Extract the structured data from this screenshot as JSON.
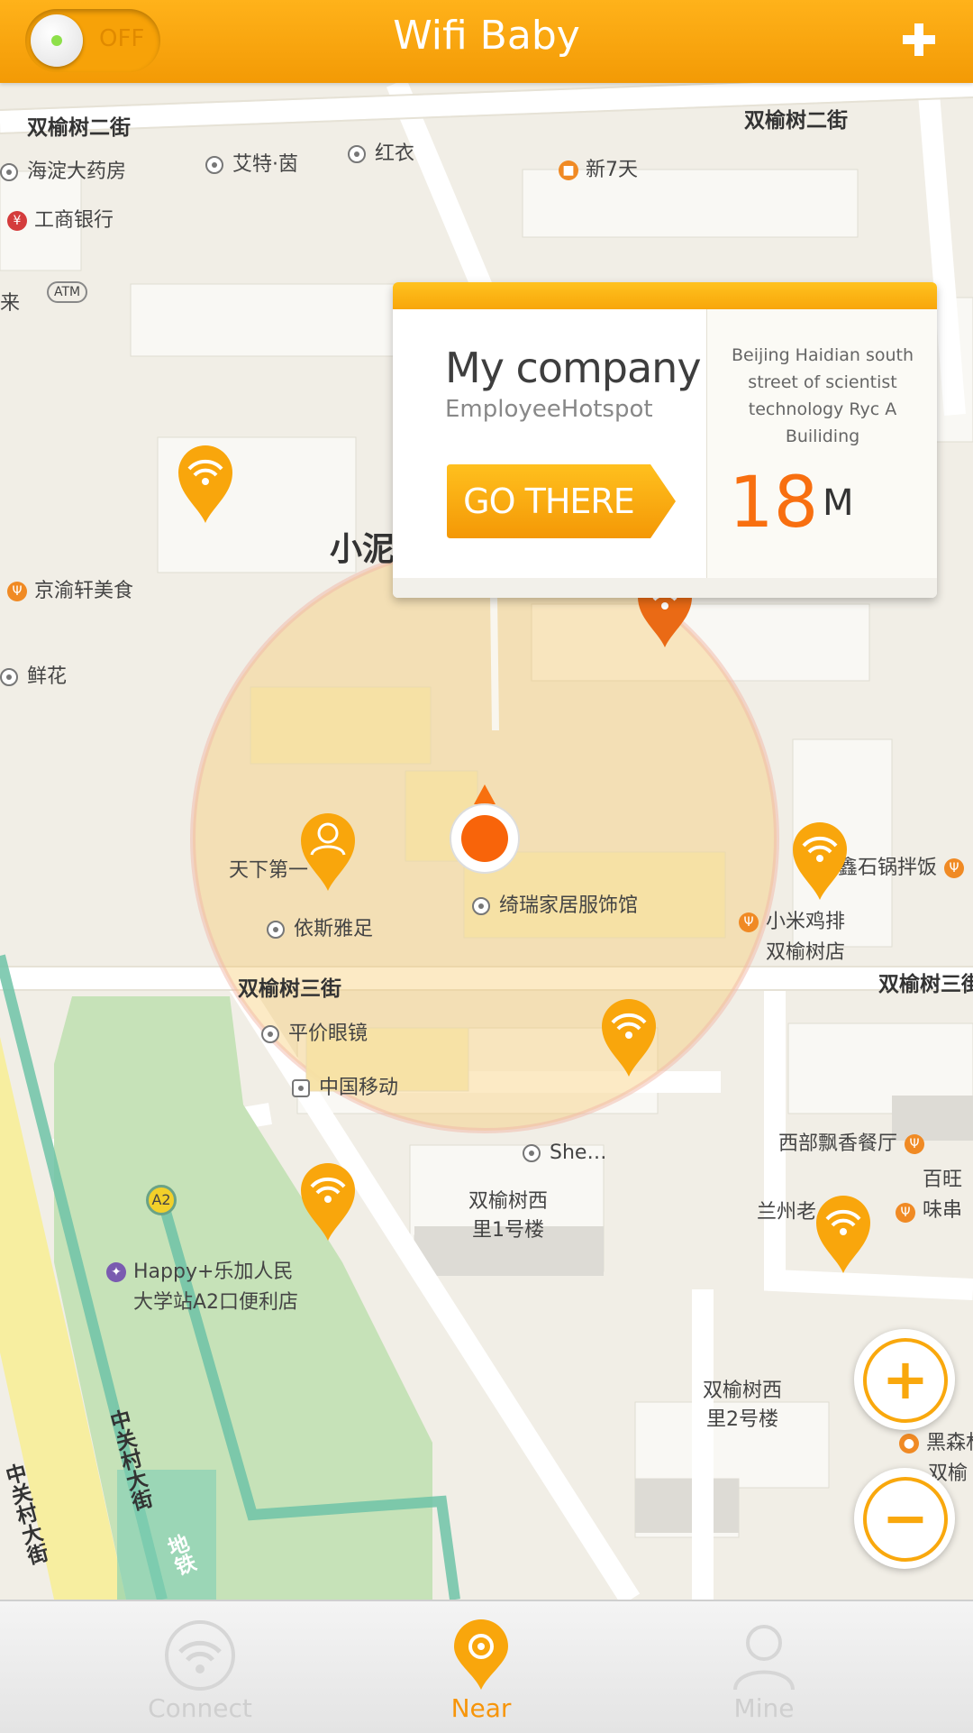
{
  "header": {
    "title": "Wifi Baby",
    "toggle_state": "OFF",
    "add_icon": "plus-icon"
  },
  "map": {
    "roads": {
      "r1": "双榆树二街",
      "r2": "双榆树二街",
      "r3": "双榆树三街",
      "r4": "双榆树三街",
      "r5": "中关村大街",
      "r6": "中关村大街",
      "r7": "地铁"
    },
    "pois": {
      "p1": "海淀大药房",
      "p2": "艾特·茵",
      "p3": "红衣",
      "p4": "新7天",
      "p5": "工商银行",
      "p6": "京渝轩美食",
      "p7": "鲜花",
      "p8": "小泥",
      "p9": "天下第一",
      "p10": "依斯雅足",
      "p11": "绮瑞家居服饰馆",
      "p12": "鑫石锅拌饭",
      "p13": "小米鸡排",
      "p14": "双榆树店",
      "p15": "平价眼镜",
      "p16": "中国移动",
      "p17": "She…",
      "p18": "西部飘香餐厅",
      "p19": "兰州老",
      "p20": "百旺",
      "p21": "味串",
      "p22": "双榆树西",
      "p23": "里1号楼",
      "p24": "Happy+乐加人民",
      "p25": "大学站A2口便利店",
      "p26": "双榆树西",
      "p27": "里2号楼",
      "p28": "黑森林",
      "p29": "双榆",
      "p30": "A2",
      "p31": "ATM",
      "p32": "来"
    },
    "search_radius_color": "#f7a81b"
  },
  "popup": {
    "name": "My company",
    "subtitle": "EmployeeHotspot",
    "button_label": "GO THERE",
    "address": "Beijing Haidian south street of scientist technology Ryc A Builiding",
    "distance": "18",
    "unit": "M"
  },
  "zoom": {
    "in_label": "+",
    "out_label": "−"
  },
  "tabs": [
    {
      "label": "Connect",
      "icon": "wifi-icon",
      "active": false
    },
    {
      "label": "Near",
      "icon": "location-pin-icon",
      "active": true
    },
    {
      "label": "Mine",
      "icon": "user-icon",
      "active": false
    }
  ],
  "colors": {
    "accent": "#f9a80d",
    "distance": "#f86f10",
    "active_tab": "#f7950a",
    "inactive_tab": "#cfcfcf"
  }
}
